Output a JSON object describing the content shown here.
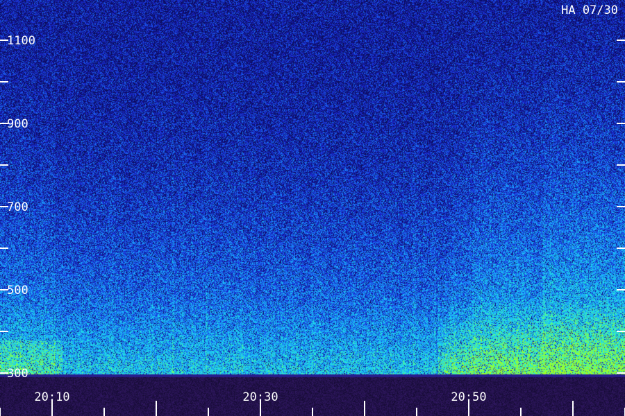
{
  "station_label": "HA 07/30",
  "chart_data": {
    "type": "heatmap",
    "title": "",
    "xlabel": "",
    "ylabel": "",
    "x_tick_labels": [
      "20:10",
      "20:30",
      "20:50"
    ],
    "x_range": [
      "20:05",
      "21:05"
    ],
    "y_tick_labels": [
      "1100",
      "900",
      "700",
      "500",
      "300"
    ],
    "y_range": [
      300,
      1100
    ],
    "y_major_step": 200,
    "y_minor_step": 100,
    "x_minor_step_minutes": 5,
    "colormap": [
      "#0c0c5c",
      "#1a28d8",
      "#1aa0ff",
      "#20f0e0",
      "#a0ff20"
    ],
    "grid": false
  }
}
